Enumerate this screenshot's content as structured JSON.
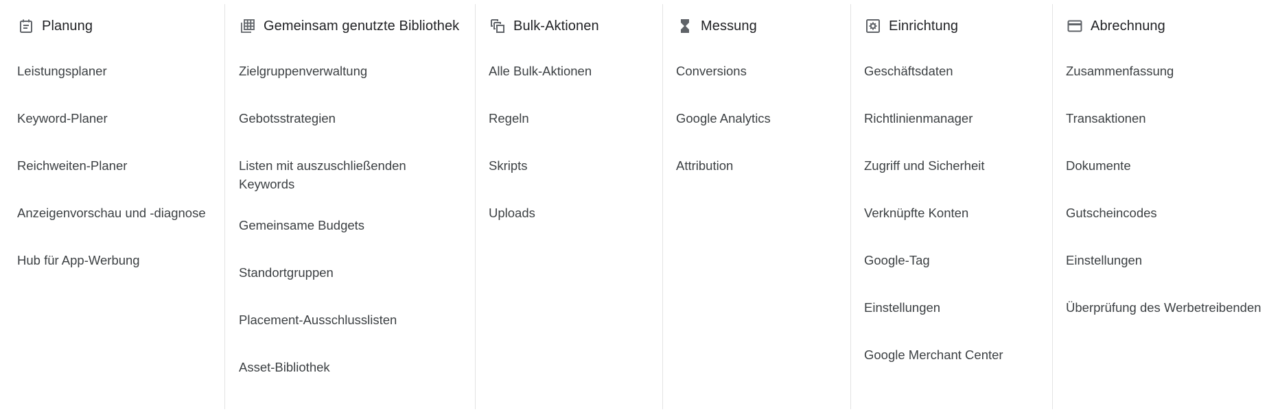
{
  "columns": [
    {
      "id": "planung",
      "title": "Planung",
      "icon": "calendar-icon",
      "items": [
        "Leistungsplaner",
        "Keyword-Planer",
        "Reichweiten-Planer",
        "Anzeigenvorschau und -diagnose",
        "Hub für App-Werbung"
      ]
    },
    {
      "id": "bibliothek",
      "title": "Gemeinsam genutzte Bibliothek",
      "icon": "library-grid-icon",
      "items": [
        "Zielgruppenverwaltung",
        "Gebotsstrategien",
        "Listen mit auszuschließenden Keywords",
        "Gemeinsame Budgets",
        "Standortgruppen",
        "Placement-Ausschlusslisten",
        "Asset-Bibliothek"
      ]
    },
    {
      "id": "bulk",
      "title": "Bulk-Aktionen",
      "icon": "copy-stack-icon",
      "items": [
        "Alle Bulk-Aktionen",
        "Regeln",
        "Skripts",
        "Uploads"
      ]
    },
    {
      "id": "messung",
      "title": "Messung",
      "icon": "hourglass-icon",
      "items": [
        "Conversions",
        "Google Analytics",
        "Attribution"
      ]
    },
    {
      "id": "einrichtung",
      "title": "Einrichtung",
      "icon": "settings-box-icon",
      "items": [
        "Geschäftsdaten",
        "Richtlinienmanager",
        "Zugriff und Sicherheit",
        "Verknüpfte Konten",
        "Google-Tag",
        "Einstellungen",
        "Google Merchant Center"
      ]
    },
    {
      "id": "abrechnung",
      "title": "Abrechnung",
      "icon": "credit-card-icon",
      "items": [
        "Zusammenfassung",
        "Transaktionen",
        "Dokumente",
        "Gutscheincodes",
        "Einstellungen",
        "Überprüfung des Werbetreibenden"
      ]
    }
  ]
}
